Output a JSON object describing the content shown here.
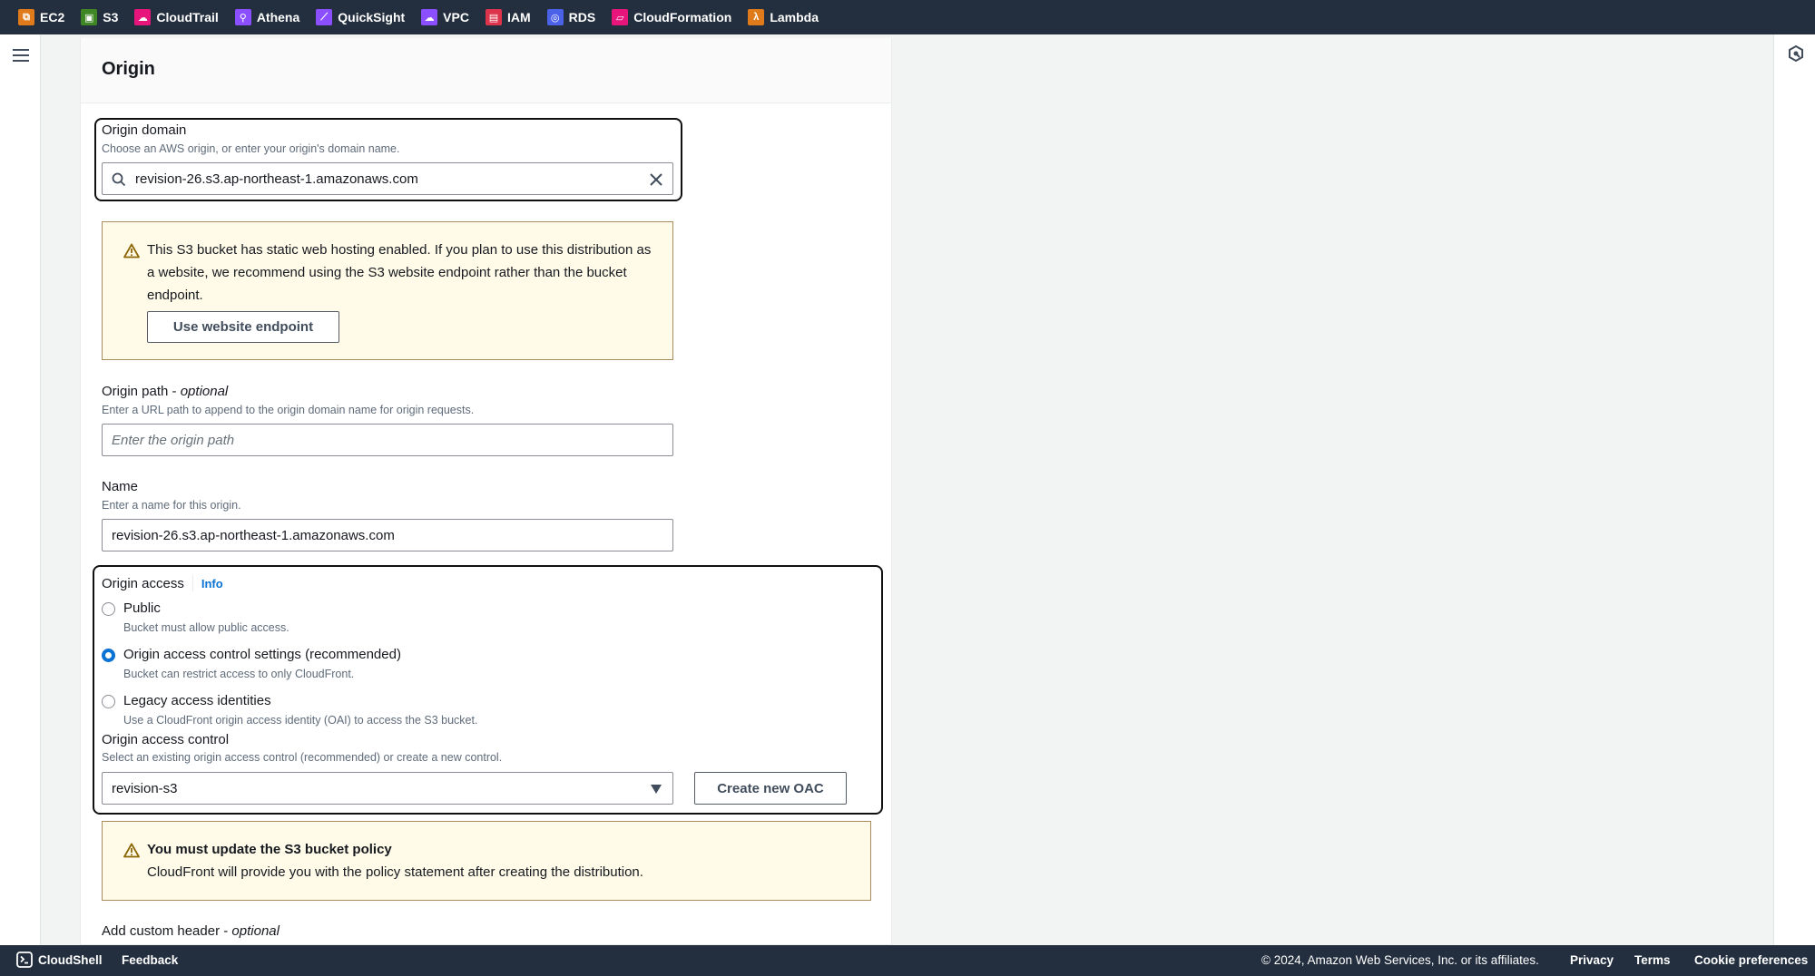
{
  "nav": {
    "services": [
      {
        "label": "EC2",
        "icon": "ec2-icon",
        "color": "#e07b1b",
        "glyph": "⧉"
      },
      {
        "label": "S3",
        "icon": "s3-icon",
        "color": "#3f8624",
        "glyph": "▣"
      },
      {
        "label": "CloudTrail",
        "icon": "cloudtrail-icon",
        "color": "#e7157b",
        "glyph": "☁"
      },
      {
        "label": "Athena",
        "icon": "athena-icon",
        "color": "#8c4fff",
        "glyph": "⚲"
      },
      {
        "label": "QuickSight",
        "icon": "quicksight-icon",
        "color": "#8c4fff",
        "glyph": "⟋"
      },
      {
        "label": "VPC",
        "icon": "vpc-icon",
        "color": "#8c4fff",
        "glyph": "☁"
      },
      {
        "label": "IAM",
        "icon": "iam-icon",
        "color": "#dd344c",
        "glyph": "▤"
      },
      {
        "label": "RDS",
        "icon": "rds-icon",
        "color": "#4b61e8",
        "glyph": "◎"
      },
      {
        "label": "CloudFormation",
        "icon": "cloudformation-icon",
        "color": "#e7157b",
        "glyph": "▱"
      },
      {
        "label": "Lambda",
        "icon": "lambda-icon",
        "color": "#e07b1b",
        "glyph": "λ"
      }
    ]
  },
  "panel": {
    "title": "Origin",
    "origin_domain": {
      "label": "Origin domain",
      "description": "Choose an AWS origin, or enter your origin's domain name.",
      "value": "revision-26.s3.ap-northeast-1.amazonaws.com"
    },
    "hosting_warning": {
      "text": "This S3 bucket has static web hosting enabled. If you plan to use this distribution as a website, we recommend using the S3 website endpoint rather than the bucket endpoint.",
      "button": "Use website endpoint"
    },
    "origin_path": {
      "label": "Origin path - ",
      "label_optional": "optional",
      "description": "Enter a URL path to append to the origin domain name for origin requests.",
      "placeholder": "Enter the origin path"
    },
    "name": {
      "label": "Name",
      "description": "Enter a name for this origin.",
      "value": "revision-26.s3.ap-northeast-1.amazonaws.com"
    },
    "origin_access": {
      "label": "Origin access",
      "info": "Info",
      "options": [
        {
          "label": "Public",
          "description": "Bucket must allow public access.",
          "checked": false
        },
        {
          "label": "Origin access control settings (recommended)",
          "description": "Bucket can restrict access to only CloudFront.",
          "checked": true
        },
        {
          "label": "Legacy access identities",
          "description": "Use a CloudFront origin access identity (OAI) to access the S3 bucket.",
          "checked": false
        }
      ],
      "control": {
        "label": "Origin access control",
        "description": "Select an existing origin access control (recommended) or create a new control.",
        "selected": "revision-s3",
        "create_button": "Create new OAC"
      }
    },
    "policy_warning": {
      "title": "You must update the S3 bucket policy",
      "text": "CloudFront will provide you with the policy statement after creating the distribution."
    },
    "custom_header": {
      "label": "Add custom header - ",
      "label_optional": "optional"
    }
  },
  "footer": {
    "cloudshell": "CloudShell",
    "feedback": "Feedback",
    "copyright": "© 2024, Amazon Web Services, Inc. or its affiliates.",
    "privacy": "Privacy",
    "terms": "Terms",
    "cookies": "Cookie preferences"
  },
  "colors": {
    "nav_bg": "#232f3e",
    "accent": "#0972d3",
    "warning_bg": "#fffbe8",
    "warning_border": "#a88b5f"
  }
}
